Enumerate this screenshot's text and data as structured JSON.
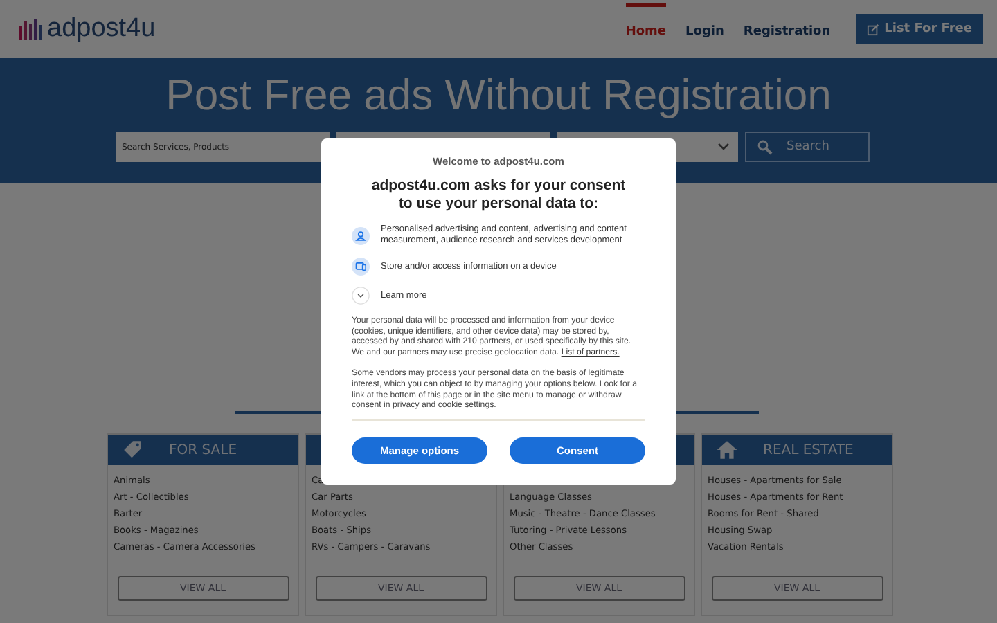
{
  "header": {
    "logo": "adpost4u",
    "nav": [
      {
        "label": "Home",
        "selected": true
      },
      {
        "label": "Login",
        "selected": false
      },
      {
        "label": "Registration",
        "selected": false
      }
    ],
    "cta": "List For Free"
  },
  "hero": {
    "title": "Post Free ads Without Registration",
    "search_placeholder": "Search Services, Products",
    "search_button": "Search"
  },
  "cards": [
    {
      "title": "FOR SALE",
      "kind": "tag",
      "items": [
        "Animals",
        "Art - Collectibles",
        "Barter",
        "Books - Magazines",
        "Cameras - Camera Accessories"
      ],
      "button": "VIEW ALL"
    },
    {
      "items": [
        "Ca",
        "Car Parts",
        "Motorcycles",
        "Boats - Ships",
        "RVs - Campers - Caravans"
      ],
      "button": "VIEW ALL"
    },
    {
      "items": [
        "Language Classes",
        "Music - Theatre - Dance Classes",
        "Tutoring - Private Lessons",
        "Other Classes"
      ],
      "button": "VIEW ALL"
    },
    {
      "title": "REAL ESTATE",
      "kind": "house",
      "items": [
        "Houses - Apartments for Sale",
        "Houses - Apartments for Rent",
        "Rooms for Rent - Shared",
        "Housing Swap",
        "Vacation Rentals"
      ],
      "button": "VIEW ALL"
    }
  ],
  "consent": {
    "welcome": "Welcome to adpost4u.com",
    "heading": "adpost4u.com asks for your consent to use your personal data to:",
    "purposes": [
      {
        "kind": "person",
        "text": "Personalised advertising and content, advertising and content measurement, audience research and services development"
      },
      {
        "kind": "device",
        "text": "Store and/or access information on a device"
      }
    ],
    "learn_more": "Learn more",
    "paragraphs": [
      {
        "text": "Your personal data will be processed and information from your device (cookies, unique identifiers, and other device data) may be stored by, accessed by and shared with 210 partners, or used specifically by this site. We and our partners may use precise geolocation data.",
        "link": "List of partners."
      },
      {
        "text": "Some vendors may process your personal data on the basis of legitimate interest, which you can object to by managing your options below. Look for a link at the bottom of this page or in the site menu to manage or withdraw consent in privacy and cookie settings."
      }
    ],
    "buttons": [
      "Manage options",
      "Consent"
    ]
  }
}
